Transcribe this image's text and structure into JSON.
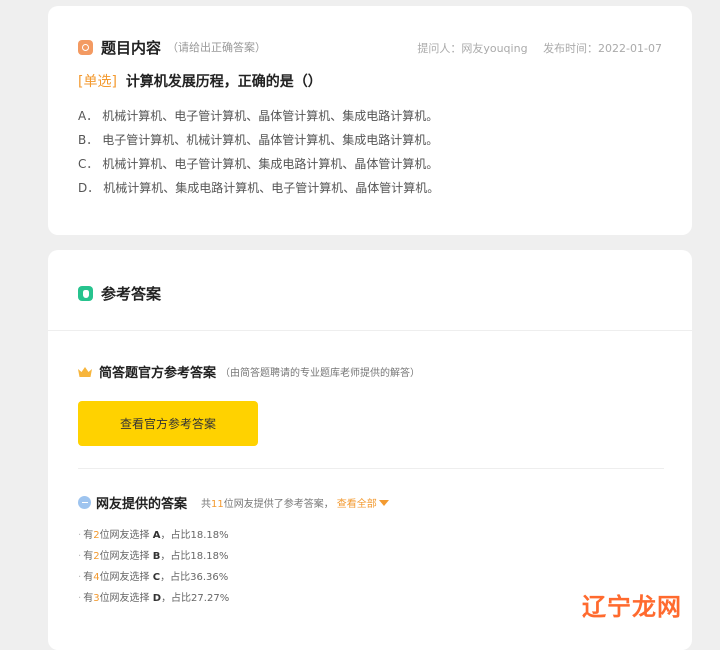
{
  "question": {
    "title": "题目内容",
    "hint": "（请给出正确答案）",
    "asker": "提问人：网友youqing",
    "publish_time": "发布时间：2022-01-07",
    "type_label": "[单选]",
    "stem": "计算机发展历程，正确的是（）",
    "options": [
      {
        "key": "A．",
        "text": "机械计算机、电子管计算机、晶体管计算机、集成电路计算机。"
      },
      {
        "key": "B．",
        "text": "电子管计算机、机械计算机、晶体管计算机、集成电路计算机。"
      },
      {
        "key": "C．",
        "text": "机械计算机、电子管计算机、集成电路计算机、晶体管计算机。"
      },
      {
        "key": "D．",
        "text": "机械计算机、集成电路计算机、电子管计算机、晶体管计算机。"
      }
    ]
  },
  "answer": {
    "title": "参考答案",
    "official": {
      "title": "简答题官方参考答案",
      "desc": "（由简答题聘请的专业题库老师提供的解答）",
      "button_label": "查看官方参考答案"
    },
    "users": {
      "title": "网友提供的答案",
      "summary_prefix": "共",
      "summary_count": "11",
      "summary_suffix": "位网友提供了参考答案，",
      "view_all_label": "查看全部",
      "choices": [
        {
          "prefix": "有",
          "count": "2",
          "middle": "位网友选择 ",
          "option": "A",
          "suffix": "，占比18.18%"
        },
        {
          "prefix": "有",
          "count": "2",
          "middle": "位网友选择 ",
          "option": "B",
          "suffix": "，占比18.18%"
        },
        {
          "prefix": "有",
          "count": "4",
          "middle": "位网友选择 ",
          "option": "C",
          "suffix": "，占比36.36%"
        },
        {
          "prefix": "有",
          "count": "3",
          "middle": "位网友选择 ",
          "option": "D",
          "suffix": "，占比27.27%"
        }
      ]
    }
  },
  "watermark": "辽宁龙网",
  "colors": {
    "accent_orange": "#f39a30",
    "button_yellow": "#ffd200",
    "question_icon": "#f39a62",
    "answer_icon": "#27c38e"
  }
}
